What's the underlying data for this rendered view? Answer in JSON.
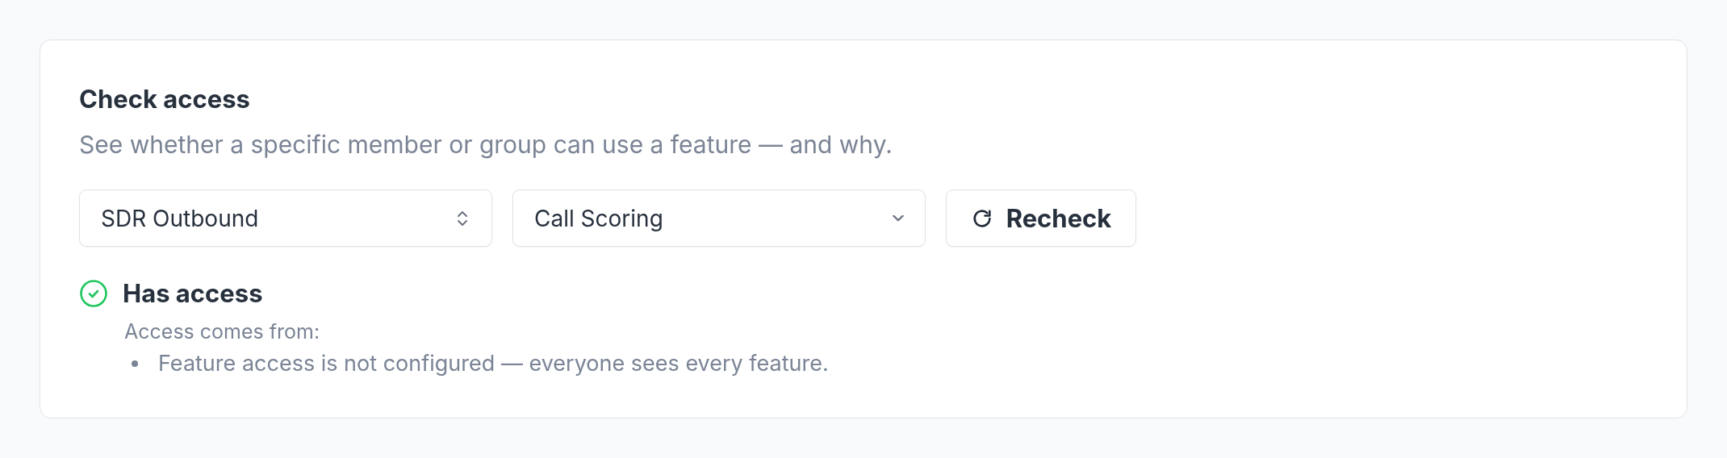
{
  "card": {
    "title": "Check access",
    "description": "See whether a specific member or group can use a feature — and why.",
    "selects": [
      {
        "kind": "combobox",
        "value": "SDR Outbound"
      },
      {
        "kind": "dropdown",
        "value": "Call Scoring"
      }
    ],
    "recheck_button": {
      "label": "Recheck"
    },
    "result": {
      "kind": "granted",
      "heading": "Has access",
      "source_label": "Access comes from:",
      "reasons": [
        "Feature access is not configured — everyone sees every feature."
      ]
    }
  }
}
